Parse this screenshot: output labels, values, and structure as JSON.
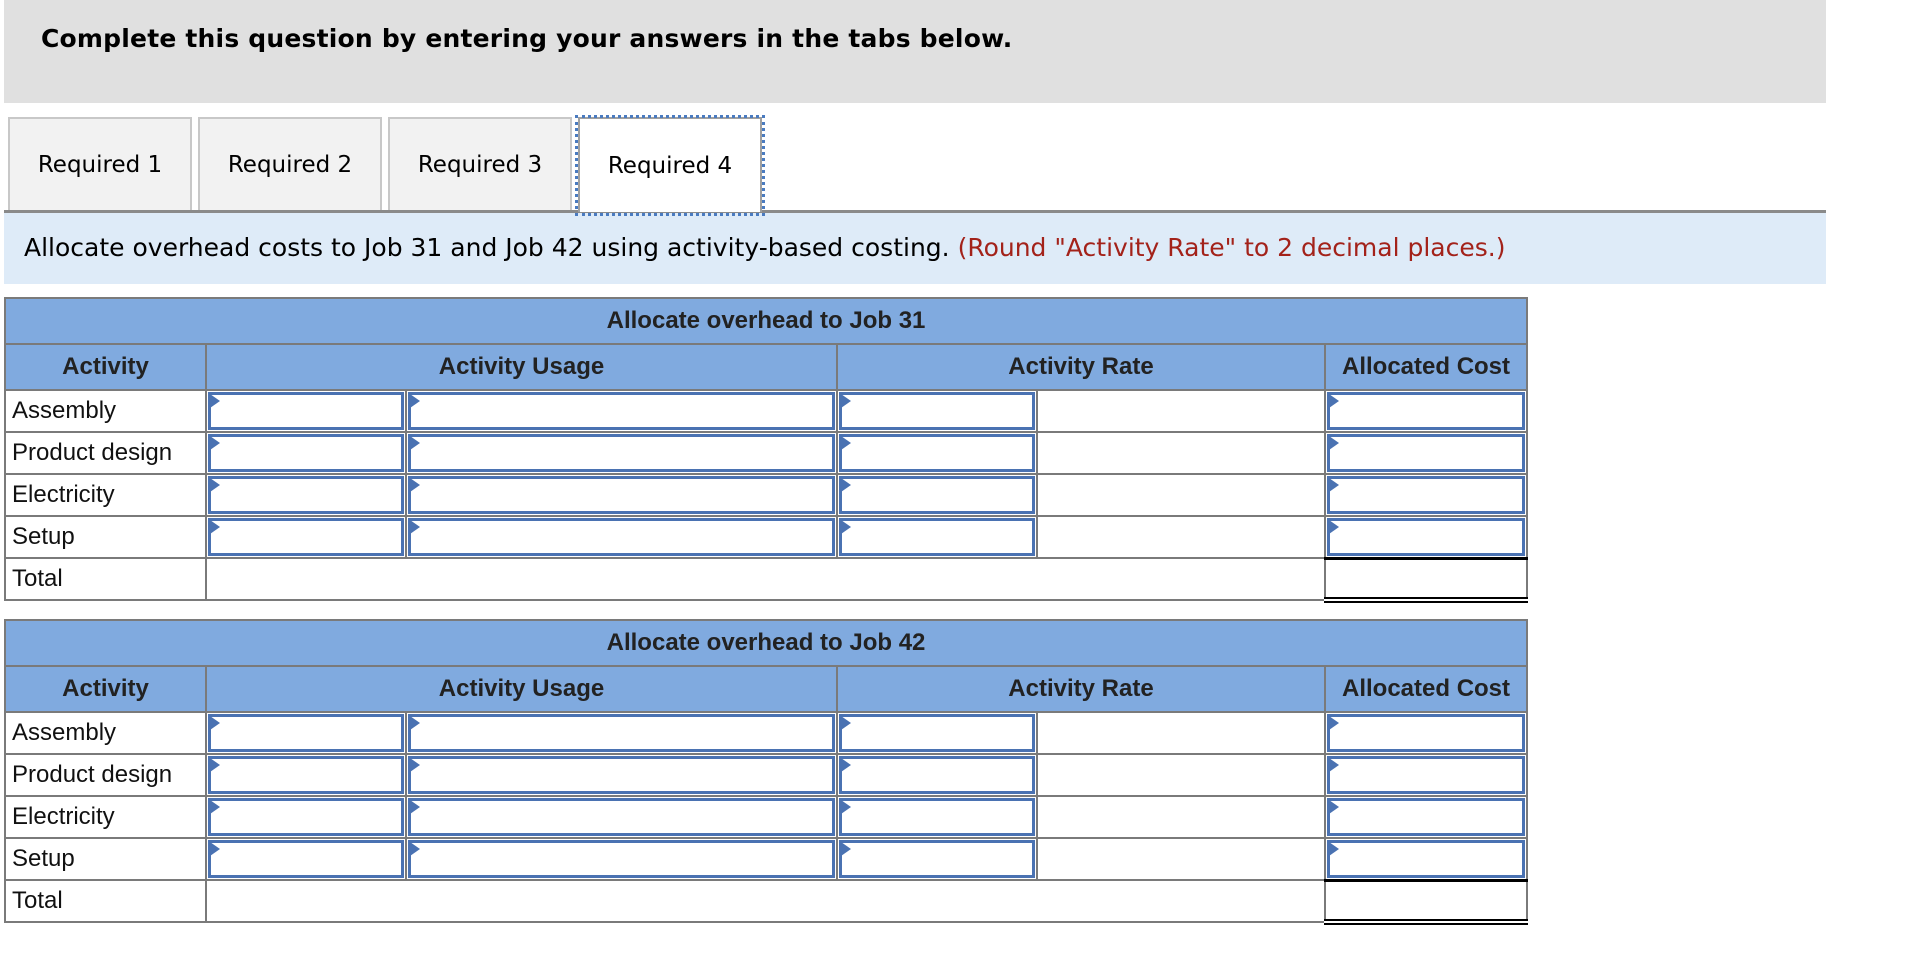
{
  "header": {
    "title": "Complete this question by entering your answers in the tabs below."
  },
  "tabs": [
    {
      "label": "Required 1",
      "active": false
    },
    {
      "label": "Required 2",
      "active": false
    },
    {
      "label": "Required 3",
      "active": false
    },
    {
      "label": "Required 4",
      "active": true
    }
  ],
  "instructions": {
    "main": "Allocate overhead costs to Job 31 and Job 42 using activity-based costing.",
    "note": "(Round \"Activity Rate\" to 2 decimal places.)",
    "note_color": "#a3221a"
  },
  "tables": [
    {
      "title": "Allocate overhead to Job 31",
      "headers": {
        "activity": "Activity",
        "usage": "Activity Usage",
        "rate": "Activity Rate",
        "cost": "Allocated Cost"
      },
      "rows": [
        {
          "activity": "Assembly",
          "usage_a": "",
          "usage_b": "",
          "rate": "",
          "cost": ""
        },
        {
          "activity": "Product design",
          "usage_a": "",
          "usage_b": "",
          "rate": "",
          "cost": ""
        },
        {
          "activity": "Electricity",
          "usage_a": "",
          "usage_b": "",
          "rate": "",
          "cost": ""
        },
        {
          "activity": "Setup",
          "usage_a": "",
          "usage_b": "",
          "rate": "",
          "cost": ""
        }
      ],
      "total_label": "Total",
      "total_value": ""
    },
    {
      "title": "Allocate overhead to Job 42",
      "headers": {
        "activity": "Activity",
        "usage": "Activity Usage",
        "rate": "Activity Rate",
        "cost": "Allocated Cost"
      },
      "rows": [
        {
          "activity": "Assembly",
          "usage_a": "",
          "usage_b": "",
          "rate": "",
          "cost": ""
        },
        {
          "activity": "Product design",
          "usage_a": "",
          "usage_b": "",
          "rate": "",
          "cost": ""
        },
        {
          "activity": "Electricity",
          "usage_a": "",
          "usage_b": "",
          "rate": "",
          "cost": ""
        },
        {
          "activity": "Setup",
          "usage_a": "",
          "usage_b": "",
          "rate": "",
          "cost": ""
        }
      ],
      "total_label": "Total",
      "total_value": ""
    }
  ],
  "colors": {
    "header_bg": "#e0e0e0",
    "instr_bg": "#deebf8",
    "table_head_bg": "#80aadf",
    "input_border": "#4a72b2"
  }
}
